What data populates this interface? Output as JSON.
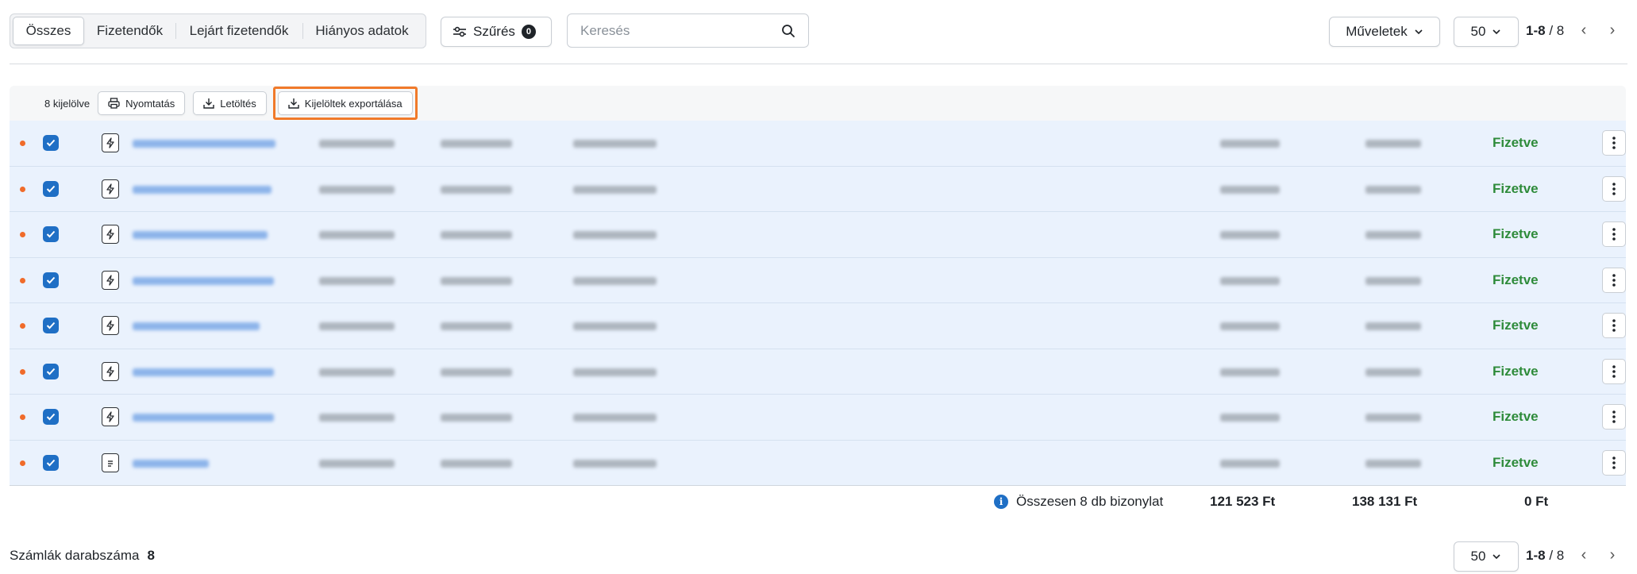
{
  "tabs": [
    {
      "label": "Összes",
      "active": true
    },
    {
      "label": "Fizetendők",
      "active": false
    },
    {
      "label": "Lejárt fizetendők",
      "active": false
    },
    {
      "label": "Hiányos adatok",
      "active": false
    }
  ],
  "filter": {
    "label": "Szűrés",
    "count": "0"
  },
  "search": {
    "placeholder": "Keresés",
    "value": ""
  },
  "actions": {
    "label": "Műveletek"
  },
  "pagination": {
    "per_page": "50",
    "range": "1-8",
    "total": "/ 8"
  },
  "selection": {
    "count_label": "8 kijelölve",
    "print_label": "Nyomtatás",
    "download_label": "Letöltés",
    "export_label": "Kijelöltek exportálása"
  },
  "rows": [
    {
      "status": "Fizetve",
      "icon": "bolt-document-icon"
    },
    {
      "status": "Fizetve",
      "icon": "bolt-document-icon"
    },
    {
      "status": "Fizetve",
      "icon": "bolt-document-icon"
    },
    {
      "status": "Fizetve",
      "icon": "bolt-document-icon"
    },
    {
      "status": "Fizetve",
      "icon": "bolt-document-icon"
    },
    {
      "status": "Fizetve",
      "icon": "bolt-document-icon"
    },
    {
      "status": "Fizetve",
      "icon": "bolt-document-icon"
    },
    {
      "status": "Fizetve",
      "icon": "text-document-icon"
    }
  ],
  "totals": {
    "label": "Összesen 8 db bizonylat",
    "net": "121 523  Ft",
    "gross": "138 131  Ft",
    "due": "0  Ft"
  },
  "footer": {
    "count_label": "Számlák darabszáma",
    "count_value": "8"
  },
  "colors": {
    "accent": "#1f6fc5",
    "paid": "#2e8b3a",
    "highlight": "#f07a2a",
    "row_bg": "#eaf2fd"
  }
}
